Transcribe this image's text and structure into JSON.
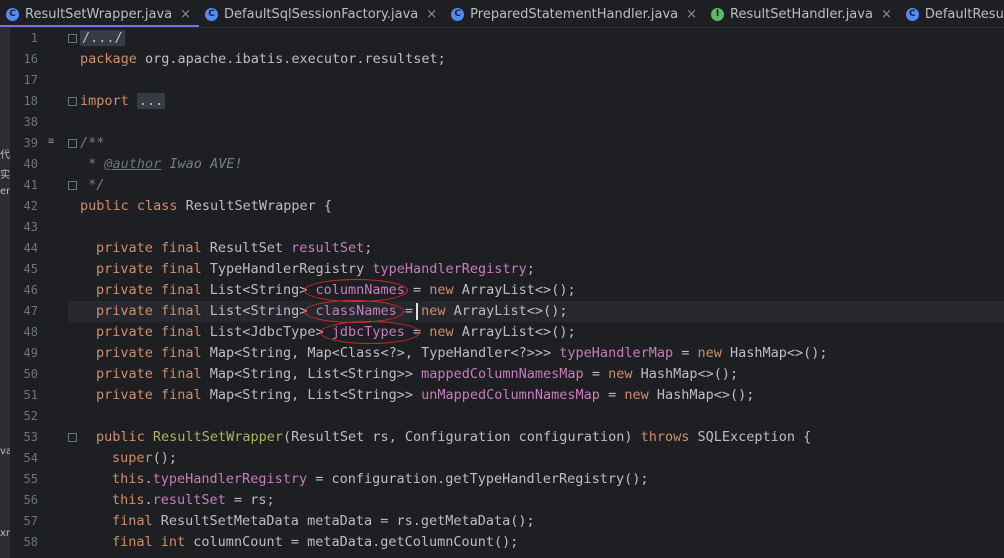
{
  "tabs": [
    {
      "label": "ResultSetWrapper.java",
      "icon": "class",
      "active": true
    },
    {
      "label": "DefaultSqlSessionFactory.java",
      "icon": "class",
      "active": false
    },
    {
      "label": "PreparedStatementHandler.java",
      "icon": "class",
      "active": false
    },
    {
      "label": "ResultSetHandler.java",
      "icon": "interface",
      "active": false
    },
    {
      "label": "DefaultResultSetHandler.java",
      "icon": "class",
      "active": false
    }
  ],
  "tab_close_glyph": "×",
  "left_panel_fragments": [
    "代",
    "实",
    "en",
    "va",
    "xn"
  ],
  "lines": [
    "1",
    "16",
    "17",
    "18",
    "38",
    "39",
    "40",
    "41",
    "42",
    "43",
    "44",
    "45",
    "46",
    "47",
    "48",
    "49",
    "50",
    "51",
    "52",
    "53",
    "54",
    "55",
    "56",
    "57",
    "58"
  ],
  "code": {
    "l1": "/.../",
    "l16_kw": "package",
    "l16_rest": " org.apache.ibatis.executor.resultset;",
    "l18_kw": "import",
    "l18_fold": "...",
    "l39": "/**",
    "l40_star": " * ",
    "l40_tag": "@author",
    "l40_rest": " Iwao AVE!",
    "l41": " */",
    "l42_kw": "public class",
    "l42_rest": " ResultSetWrapper {",
    "pf": "private final",
    "l44_type": " ResultSet ",
    "l44_fld": "resultSet",
    "l45_type": " TypeHandlerRegistry ",
    "l45_fld": "typeHandlerRegistry",
    "l46_type": " List<String> ",
    "l46_fld": "columnNames",
    "l47_type": " List<String> ",
    "l47_fld": "classNames",
    "l48_type": " List<JdbcType> ",
    "l48_fld": "jdbcTypes",
    "l49_type": " Map<String, Map<Class<?>, TypeHandler<?>>> ",
    "l49_fld": "typeHandlerMap",
    "l49_tail": "HashMap<>();",
    "l50_type": " Map<String, List<String>> ",
    "l50_fld": "mappedColumnNamesMap",
    "l50_tail": "HashMap<>();",
    "l51_type": " Map<String, List<String>> ",
    "l51_fld": "unMappedColumnNamesMap",
    "l51_tail": "HashMap<>();",
    "eq_new": " = ",
    "new_kw": "new",
    "alist": " ArrayList<>();",
    "semi": ";",
    "l53_kw": "public",
    "l53_ctor": "ResultSetWrapper",
    "l53_params": "(ResultSet rs, Configuration configuration) ",
    "l53_throws": "throws",
    "l53_tail": " SQLException {",
    "l54_kw": "super",
    "l54_tail": "();",
    "this_kw": "this",
    "l55_fld": "typeHandlerRegistry",
    "l55_tail": " = configuration.getTypeHandlerRegistry();",
    "l56_fld": "resultSet",
    "l56_tail": " = rs;",
    "final_kw": "final",
    "l57_rest": " ResultSetMetaData metaData = rs.getMetaData();",
    "l58_int": "int",
    "l58_rest": " columnCount = metaData.getColumnCount();"
  }
}
